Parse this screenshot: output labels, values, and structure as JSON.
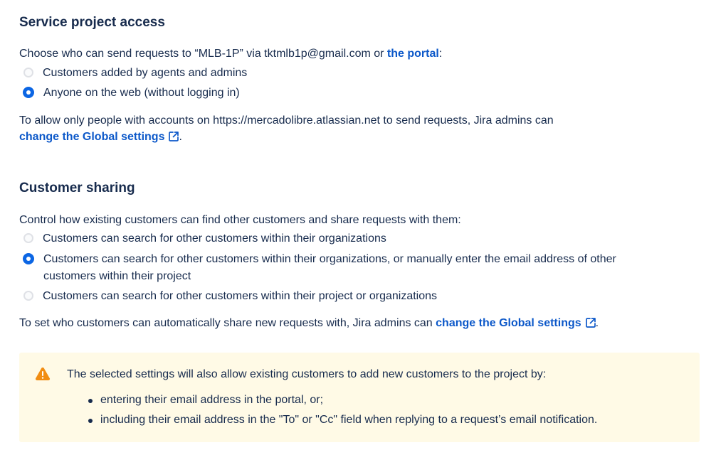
{
  "service_access": {
    "heading": "Service project access",
    "intro_prefix": "Choose who can send requests to “MLB-1P” via tktmlb1p@gmail.com or ",
    "intro_link": "the portal",
    "intro_suffix": ":",
    "options": [
      {
        "label": "Customers added by agents and admins",
        "selected": false
      },
      {
        "label": "Anyone on the web (without logging in)",
        "selected": true
      }
    ],
    "note_text": "To allow only people with accounts on https://mercadolibre.atlassian.net to send requests, Jira admins can",
    "note_link": "change the Global settings",
    "note_suffix": "."
  },
  "customer_sharing": {
    "heading": "Customer sharing",
    "intro": "Control how existing customers can find other customers and share requests with them:",
    "options": [
      {
        "label": "Customers can search for other customers within their organizations",
        "selected": false
      },
      {
        "label": "Customers can search for other customers within their organizations, or manually enter the email address of other customers within their project",
        "selected": true
      },
      {
        "label": "Customers can search for other customers within their project or organizations",
        "selected": false
      }
    ],
    "note_text": "To set who customers can automatically share new requests with, Jira admins can ",
    "note_link": "change the Global settings",
    "note_suffix": "."
  },
  "warning": {
    "title": "The selected settings will also allow existing customers to add new customers to the project by:",
    "items": [
      "entering their email address in the portal, or;",
      "including their email address in the \"To\" or \"Cc\" field when replying to a request’s email notification."
    ]
  },
  "colors": {
    "text": "#172b4d",
    "link": "#0c58c9",
    "radio_selected": "#0c66e4",
    "warning_bg": "#fffae6",
    "warning_icon": "#f18d13"
  },
  "icons": {
    "external_link": "external-link-icon",
    "warning": "warning-icon"
  }
}
